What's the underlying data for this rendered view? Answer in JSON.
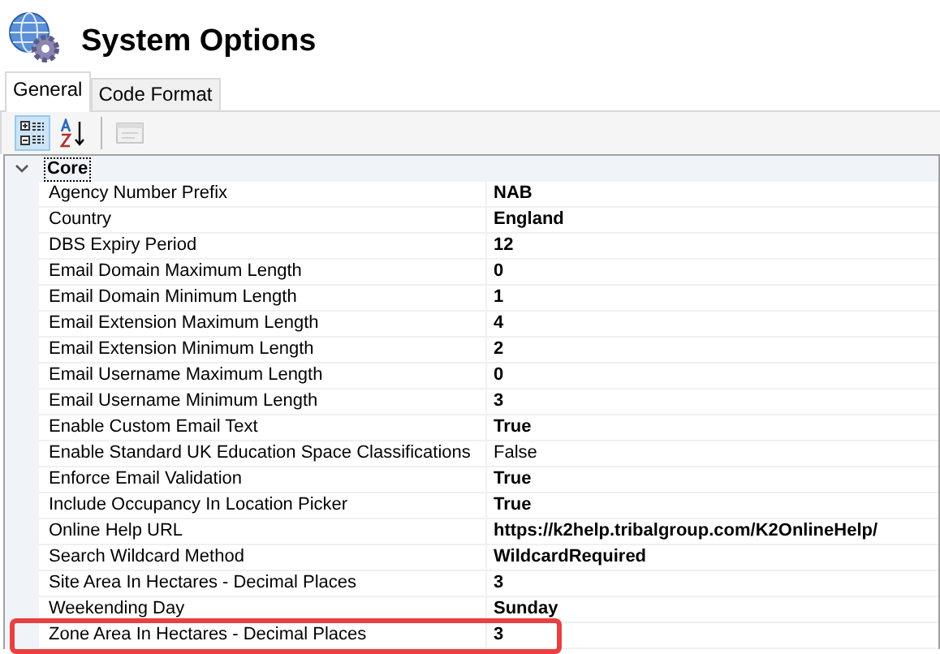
{
  "window": {
    "title": "System Options"
  },
  "tabs": [
    {
      "label": "General",
      "selected": true
    },
    {
      "label": "Code Format",
      "selected": false
    }
  ],
  "toolbar": [
    {
      "kind": "categorized",
      "selected": true,
      "disabled": false
    },
    {
      "kind": "alphabetical",
      "selected": false,
      "disabled": false
    },
    {
      "kind": "property-pages",
      "selected": false,
      "disabled": true
    }
  ],
  "categories": [
    {
      "name": "Core",
      "expanded": true,
      "properties": [
        {
          "name": "Agency Number Prefix",
          "value": "NAB",
          "modified": true,
          "highlighted": false
        },
        {
          "name": "Country",
          "value": "England",
          "modified": true,
          "highlighted": false
        },
        {
          "name": "DBS Expiry Period",
          "value": "12",
          "modified": true,
          "highlighted": false
        },
        {
          "name": "Email Domain Maximum Length",
          "value": "0",
          "modified": true,
          "highlighted": false
        },
        {
          "name": "Email Domain Minimum Length",
          "value": "1",
          "modified": true,
          "highlighted": false
        },
        {
          "name": "Email Extension Maximum Length",
          "value": "4",
          "modified": true,
          "highlighted": false
        },
        {
          "name": "Email Extension Minimum Length",
          "value": "2",
          "modified": true,
          "highlighted": false
        },
        {
          "name": "Email Username Maximum Length",
          "value": "0",
          "modified": true,
          "highlighted": false
        },
        {
          "name": "Email Username Minimum Length",
          "value": "3",
          "modified": true,
          "highlighted": false
        },
        {
          "name": "Enable Custom Email Text",
          "value": "True",
          "modified": true,
          "highlighted": false
        },
        {
          "name": "Enable Standard UK Education Space Classifications",
          "value": "False",
          "modified": false,
          "highlighted": false
        },
        {
          "name": "Enforce Email Validation",
          "value": "True",
          "modified": true,
          "highlighted": false
        },
        {
          "name": "Include Occupancy In Location Picker",
          "value": "True",
          "modified": true,
          "highlighted": false
        },
        {
          "name": "Online Help URL",
          "value": "https://k2help.tribalgroup.com/K2OnlineHelp/",
          "modified": true,
          "highlighted": false
        },
        {
          "name": "Search Wildcard Method",
          "value": "WildcardRequired",
          "modified": true,
          "highlighted": false
        },
        {
          "name": "Site Area In Hectares - Decimal Places",
          "value": "3",
          "modified": true,
          "highlighted": false
        },
        {
          "name": "Weekending Day",
          "value": "Sunday",
          "modified": true,
          "highlighted": false
        },
        {
          "name": "Zone Area In Hectares - Decimal Places",
          "value": "3",
          "modified": true,
          "highlighted": true
        }
      ]
    }
  ]
}
